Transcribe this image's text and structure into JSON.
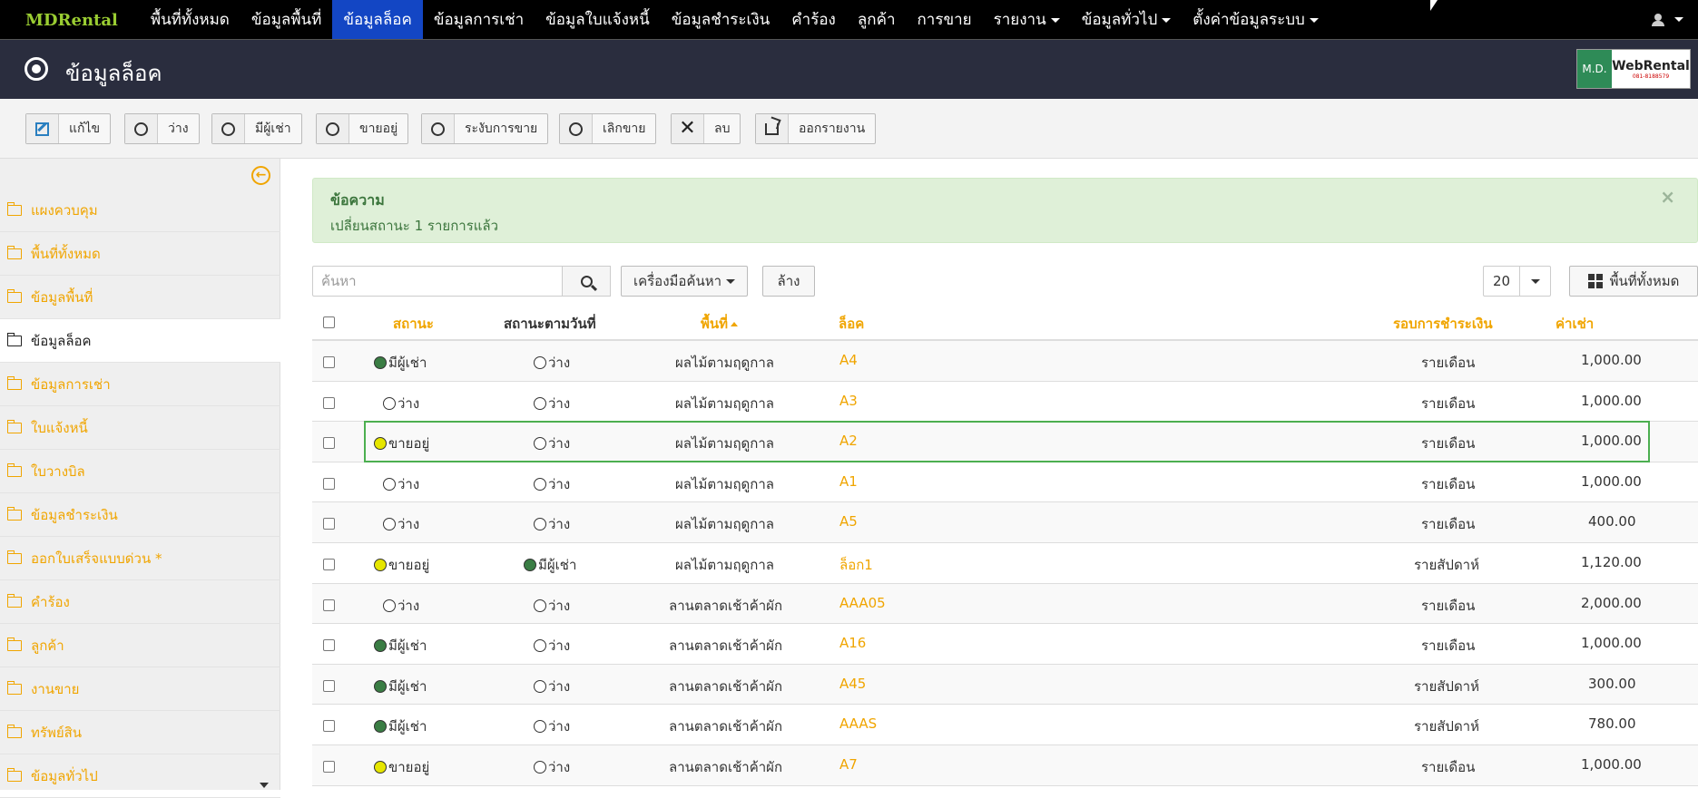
{
  "nav": {
    "brand": "MDRental",
    "items": [
      {
        "label": "พื้นที่ทั้งหมด"
      },
      {
        "label": "ข้อมูลพื้นที่"
      },
      {
        "label": "ข้อมูลล็อค"
      },
      {
        "label": "ข้อมูลการเช่า"
      },
      {
        "label": "ข้อมูลใบแจ้งหนี้"
      },
      {
        "label": "ข้อมูลชำระเงิน"
      },
      {
        "label": "คำร้อง"
      },
      {
        "label": "ลูกค้า"
      },
      {
        "label": "การขาย"
      },
      {
        "label": "รายงาน"
      },
      {
        "label": "ข้อมูลทั่วไป"
      },
      {
        "label": "ตั้งค่าข้อมูลระบบ"
      }
    ],
    "active": "ข้อมูลล็อค"
  },
  "header": {
    "title": "ข้อมูลล็อค",
    "logo_left": "M.D.",
    "logo_right": "WebRental",
    "logo_phone": "081-8188579"
  },
  "toolbar": {
    "edit": "แก้ไข",
    "vacant": "ว่าง",
    "rented": "มีผู้เช่า",
    "selling": "ขายอยู่",
    "suspend": "ระงับการขาย",
    "stop": "เลิกขาย",
    "delete": "ลบ",
    "export": "ออกรายงาน"
  },
  "sidebar": {
    "items": [
      {
        "label": "แผงควบคุม"
      },
      {
        "label": "พื้นที่ทั้งหมด"
      },
      {
        "label": "ข้อมูลพื้นที่"
      },
      {
        "label": "ข้อมูลล็อค"
      },
      {
        "label": "ข้อมูลการเช่า"
      },
      {
        "label": "ใบแจ้งหนี้"
      },
      {
        "label": "ใบวางบิล"
      },
      {
        "label": "ข้อมูลชำระเงิน"
      },
      {
        "label": "ออกใบเสร็จแบบด่วน *"
      },
      {
        "label": "คำร้อง"
      },
      {
        "label": "ลูกค้า"
      },
      {
        "label": "งานขาย"
      },
      {
        "label": "ทรัพย์สิน"
      },
      {
        "label": "ข้อมูลทั่วไป"
      }
    ]
  },
  "alert": {
    "title": "ข้อความ",
    "message": "เปลี่ยนสถานะ 1 รายการแล้ว",
    "close": "×"
  },
  "search": {
    "placeholder": "ค้นหา",
    "tools_label": "เครื่องมือค้นหา",
    "clear_label": "ล้าง",
    "page_size": "20",
    "view_label": "พื้นที่ทั้งหมด"
  },
  "table": {
    "headers": {
      "status": "สถานะ",
      "status_by_date": "สถานะตามวันที่",
      "area": "พื้นที่",
      "lock": "ล็อค",
      "billing_cycle": "รอบการชำระเงิน",
      "rent": "ค่าเช่า"
    },
    "rows": [
      {
        "status": "มีผู้เช่า",
        "status_color": "green",
        "date_status": "ว่าง",
        "date_color": "empty",
        "area": "ผลไม้ตามฤดูกาล",
        "lock": "A4",
        "cycle": "รายเดือน",
        "rent": "1,000.00"
      },
      {
        "status": "ว่าง",
        "status_color": "empty",
        "date_status": "ว่าง",
        "date_color": "empty",
        "area": "ผลไม้ตามฤดูกาล",
        "lock": "A3",
        "cycle": "รายเดือน",
        "rent": "1,000.00"
      },
      {
        "status": "ขายอยู่",
        "status_color": "yellow",
        "date_status": "ว่าง",
        "date_color": "empty",
        "area": "ผลไม้ตามฤดูกาล",
        "lock": "A2",
        "cycle": "รายเดือน",
        "rent": "1,000.00"
      },
      {
        "status": "ว่าง",
        "status_color": "empty",
        "date_status": "ว่าง",
        "date_color": "empty",
        "area": "ผลไม้ตามฤดูกาล",
        "lock": "A1",
        "cycle": "รายเดือน",
        "rent": "1,000.00"
      },
      {
        "status": "ว่าง",
        "status_color": "empty",
        "date_status": "ว่าง",
        "date_color": "empty",
        "area": "ผลไม้ตามฤดูกาล",
        "lock": "A5",
        "cycle": "รายเดือน",
        "rent": "400.00"
      },
      {
        "status": "ขายอยู่",
        "status_color": "yellow",
        "date_status": "มีผู้เช่า",
        "date_color": "green",
        "area": "ผลไม้ตามฤดูกาล",
        "lock": "ล็อก1",
        "cycle": "รายสัปดาห์",
        "rent": "1,120.00"
      },
      {
        "status": "ว่าง",
        "status_color": "empty",
        "date_status": "ว่าง",
        "date_color": "empty",
        "area": "ลานตลาดเช้าค้าผัก",
        "lock": "AAA05",
        "cycle": "รายเดือน",
        "rent": "2,000.00"
      },
      {
        "status": "มีผู้เช่า",
        "status_color": "green",
        "date_status": "ว่าง",
        "date_color": "empty",
        "area": "ลานตลาดเช้าค้าผัก",
        "lock": "A16",
        "cycle": "รายเดือน",
        "rent": "1,000.00"
      },
      {
        "status": "มีผู้เช่า",
        "status_color": "green",
        "date_status": "ว่าง",
        "date_color": "empty",
        "area": "ลานตลาดเช้าค้าผัก",
        "lock": "A45",
        "cycle": "รายสัปดาห์",
        "rent": "300.00"
      },
      {
        "status": "มีผู้เช่า",
        "status_color": "green",
        "date_status": "ว่าง",
        "date_color": "empty",
        "area": "ลานตลาดเช้าค้าผัก",
        "lock": "AAAS",
        "cycle": "รายสัปดาห์",
        "rent": "780.00"
      },
      {
        "status": "ขายอยู่",
        "status_color": "yellow",
        "date_status": "ว่าง",
        "date_color": "empty",
        "area": "ลานตลาดเช้าค้าผัก",
        "lock": "A7",
        "cycle": "รายเดือน",
        "rent": "1,000.00"
      }
    ],
    "highlighted_lock": "A2"
  },
  "colors": {
    "accent": "#f0a500",
    "nav_active": "#1346c4",
    "rented_dot": "#3a7d44",
    "selling_dot": "#e6e600",
    "highlight_border": "#4caf50"
  }
}
